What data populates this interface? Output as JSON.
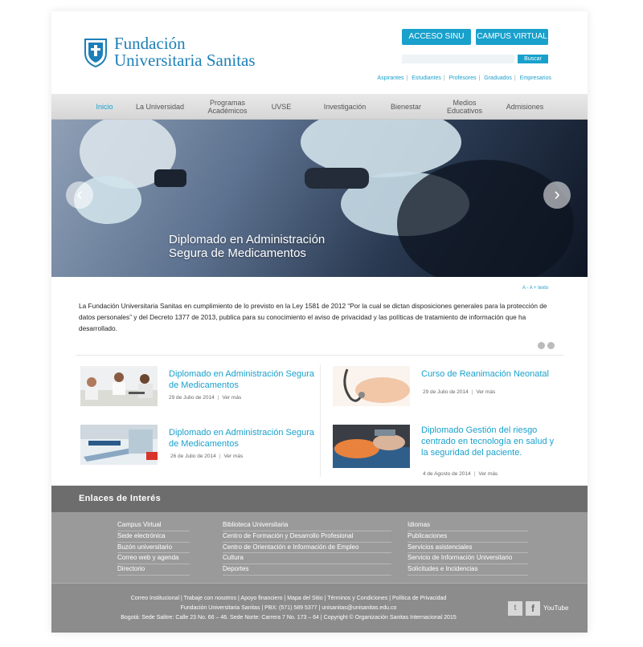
{
  "brand": {
    "name_line1": "Fundación",
    "name_line2": "Universitaria Sanitas",
    "primary_color": "#19a1cc"
  },
  "header": {
    "btn_sinu": "ACCESO SINU",
    "btn_campus": "CAMPUS VIRTUAL",
    "search_placeholder": "",
    "search_button": "Buscar",
    "quick_links": [
      "Aspirantes",
      "Estudiantes",
      "Profesores",
      "Graduados",
      "Empresarios"
    ]
  },
  "nav": {
    "items": [
      "Inicio",
      "La Universidad",
      "Programas Académicos",
      "UVSE",
      "Investigación",
      "Bienestar",
      "Medios Educativos",
      "Admisiones"
    ],
    "active_index": 0
  },
  "hero": {
    "caption_line1": "Diplomado en Administración",
    "caption_line2": "Segura de Medicamentos",
    "prev_icon": "chevron-left-icon",
    "next_icon": "chevron-right-icon"
  },
  "text_size": {
    "decrease": "A -",
    "increase": "A +",
    "label": "texto"
  },
  "privacy_notice": "La Fundación Universitaria Sanitas en cumplimiento de lo previsto en la Ley 1581 de 2012 “Por la cual se dictan disposiciones generales para la protección de datos personales” y del Decreto 1377 de 2013, publica para su conocimiento el aviso de privacidad y las políticas de tratamiento de información que ha desarrollado.",
  "news": [
    {
      "title": "Diplomado en Administración Segura de Medicamentos",
      "date": "29 de Julio de 2014",
      "more": "Ver más"
    },
    {
      "title": "Curso de Reanimación Neonatal",
      "date": "29 de Julio de 2014",
      "more": "Ver más"
    },
    {
      "title": "Diplomado en Administración Segura de Medicamentos",
      "date": "26 de Julio de 2014",
      "more": "Ver más"
    },
    {
      "title": "Diplomado Gestión del riesgo centrado en tecnología en salud y la seguridad del paciente.",
      "date": "4 de Agosto de 2014",
      "more": "Ver más"
    }
  ],
  "links": {
    "title": "Enlaces de Interés",
    "col1": [
      "Campus Virtual",
      "Sede electrónica",
      "Buzón universitario",
      "Correo web y agenda",
      "Directorio"
    ],
    "col2": [
      "Biblioteca Universitaria",
      "Centro de Formación y Desarrollo Profesional",
      "Centro de Orientación e Información de Empleo",
      "Cultura",
      "Deportes"
    ],
    "col3": [
      "Idiomas",
      "Publicaciones",
      "Servicios asistenciales",
      "Servicio de Información Universitario",
      "Solicitudes e Incidencias"
    ]
  },
  "footer": {
    "line1": "Correo Institucional | Trabaje con nosotros | Apoyo financiero | Mapa del Sitio | Términos y Condiciones | Política de Privacidad",
    "line2": "Fundación Universitaria Sanitas | PBX: (571) 589 5377 | unisanitas@unisanitas.edu.co",
    "line3": "Bogotá: Sede Salitre: Calle 23 No. 66 – 46. Sede Norte: Carrera 7 No. 173 – 64 | Copyright © Organización Sanitas Internacional 2015",
    "social_twitter": "t",
    "social_facebook": "f",
    "social_youtube": "YouTube"
  }
}
